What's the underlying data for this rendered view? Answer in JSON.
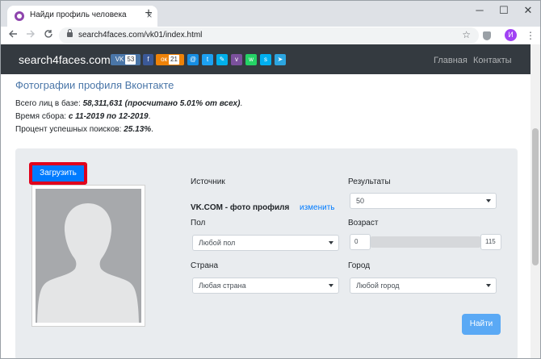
{
  "browser": {
    "tab_title": "Найди профиль человека во Вк",
    "tab_close": "×",
    "new_tab": "+",
    "window_controls": [
      "─",
      "☐",
      "✕"
    ],
    "url": "search4faces.com/vk01/index.html",
    "profile_initial": "И",
    "nav_icons": [
      "back-icon",
      "forward-icon",
      "reload-icon"
    ]
  },
  "site": {
    "brand": "search4faces.com",
    "social": [
      {
        "name": "vk",
        "label": "VK",
        "count": "53",
        "color": "#4a76a8"
      },
      {
        "name": "facebook",
        "label": "f",
        "count": "",
        "color": "#3b5998"
      },
      {
        "name": "odnoklassniki",
        "label": "ок",
        "count": "21",
        "color": "#ee8208"
      },
      {
        "name": "moimir",
        "label": "@",
        "count": "",
        "color": "#168de2"
      },
      {
        "name": "twitter",
        "label": "t",
        "count": "",
        "color": "#1da1f2"
      },
      {
        "name": "livejournal",
        "label": "✎",
        "count": "",
        "color": "#00b0ea"
      },
      {
        "name": "viber",
        "label": "v",
        "count": "",
        "color": "#7b519d"
      },
      {
        "name": "whatsapp",
        "label": "w",
        "count": "",
        "color": "#25d366"
      },
      {
        "name": "skype",
        "label": "s",
        "count": "",
        "color": "#00aff0"
      },
      {
        "name": "telegram",
        "label": "➤",
        "count": "",
        "color": "#2ca5e0"
      }
    ],
    "nav_links": [
      "Главная",
      "Контакты"
    ]
  },
  "main": {
    "title": "Фотографии профиля Вконтакте",
    "stats": {
      "faces_label": "Всего лиц в базе: ",
      "faces_value": "58,311,631",
      "faces_note": " (просчитано 5.01% от всех)",
      "faces_end": ".",
      "period_label": "Время сбора: ",
      "period_value": "с 11-2019 по 12-2019",
      "period_end": ".",
      "success_label": "Процент успешных поисков: ",
      "success_value": "25.13%",
      "success_end": "."
    }
  },
  "form": {
    "upload_label": "Загрузить",
    "source_label": "Источник",
    "source_value": "VK.COM - фото профиля",
    "source_change": "изменить",
    "results_label": "Результаты",
    "results_value": "50",
    "gender_label": "Пол",
    "gender_value": "Любой пол",
    "age_label": "Возраст",
    "age_min": "0",
    "age_max": "115",
    "country_label": "Страна",
    "country_value": "Любая страна",
    "city_label": "Город",
    "city_value": "Любой город",
    "find_label": "Найти"
  }
}
